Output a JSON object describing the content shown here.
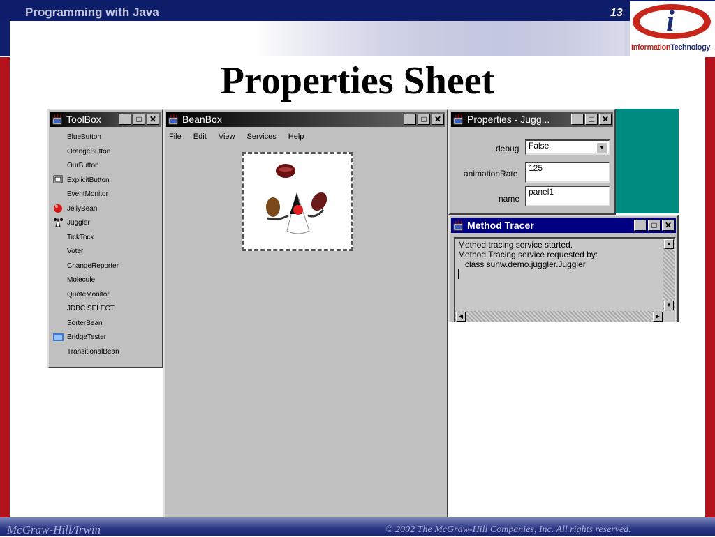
{
  "slide": {
    "course": "Programming with Java",
    "page_number": "13",
    "title": "Properties Sheet",
    "footer_left": "McGraw-Hill/Irwin",
    "footer_right": "© 2002  The McGraw-Hill Companies, Inc. All rights reserved.",
    "logo_text_a": "Information",
    "logo_text_b": "Technology"
  },
  "toolbox": {
    "title": "ToolBox",
    "items": [
      {
        "label": "BlueButton",
        "icon": ""
      },
      {
        "label": "OrangeButton",
        "icon": ""
      },
      {
        "label": "OurButton",
        "icon": ""
      },
      {
        "label": "ExplicitButton",
        "icon": "button-icon"
      },
      {
        "label": "EventMonitor",
        "icon": ""
      },
      {
        "label": "JellyBean",
        "icon": "jellybean-icon"
      },
      {
        "label": "Juggler",
        "icon": "juggler-icon"
      },
      {
        "label": "TickTock",
        "icon": ""
      },
      {
        "label": "Voter",
        "icon": ""
      },
      {
        "label": "ChangeReporter",
        "icon": ""
      },
      {
        "label": "Molecule",
        "icon": ""
      },
      {
        "label": "QuoteMonitor",
        "icon": ""
      },
      {
        "label": "JDBC SELECT",
        "icon": ""
      },
      {
        "label": "SorterBean",
        "icon": ""
      },
      {
        "label": "BridgeTester",
        "icon": "bridge-icon"
      },
      {
        "label": "TransitionalBean",
        "icon": ""
      }
    ]
  },
  "beanbox": {
    "title": "BeanBox",
    "menu": [
      "File",
      "Edit",
      "View",
      "Services",
      "Help"
    ]
  },
  "properties": {
    "title": "Properties - Jugg...",
    "debug_label": "debug",
    "debug_value": "False",
    "animation_label": "animationRate",
    "animation_value": "125",
    "name_label": "name",
    "name_value": "panel1"
  },
  "tracer": {
    "title": "Method Tracer",
    "lines": [
      "Method tracing service started.",
      "Method Tracing service requested by:",
      "   class sunw.demo.juggler.Juggler"
    ]
  },
  "window_buttons": {
    "minimize": "_",
    "maximize": "□",
    "close": "✕"
  },
  "colors": {
    "slide_blue": "#0e1d6a",
    "slide_red": "#b3141b",
    "desktop_teal": "#008b80",
    "active_title": "#000080"
  }
}
